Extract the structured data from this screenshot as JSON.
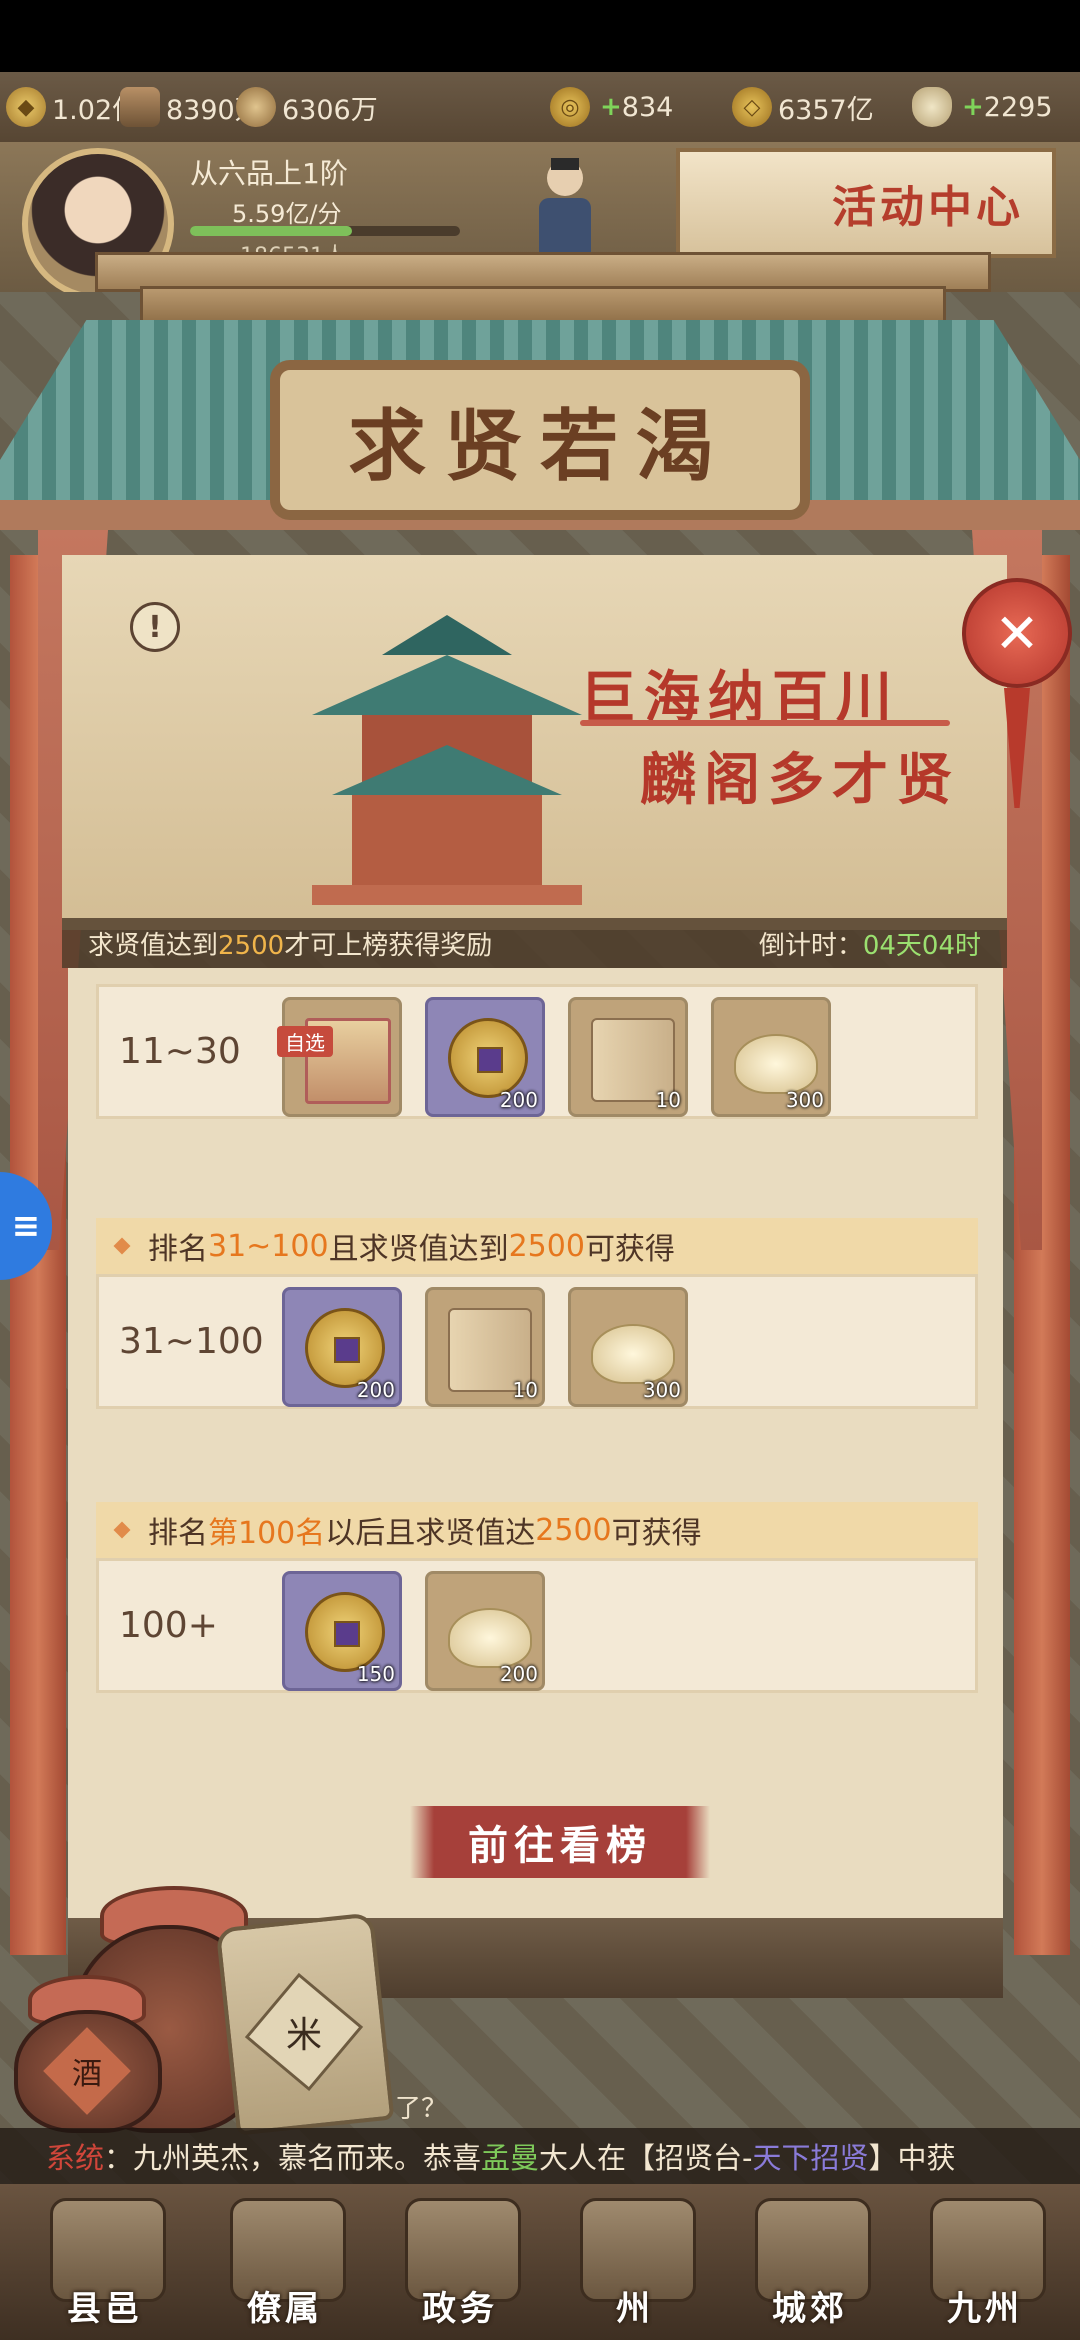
{
  "resources": [
    {
      "icon": "silver-icon",
      "value": "1.02亿",
      "plus": false
    },
    {
      "icon": "wood-icon",
      "value": "8390万",
      "plus": false
    },
    {
      "icon": "grain-icon",
      "value": "6306万",
      "plus": false
    },
    {
      "icon": "coin-icon",
      "value": "834",
      "plus": true
    },
    {
      "icon": "copper-coin-icon",
      "value": "6357亿",
      "plus": false
    },
    {
      "icon": "ingot-icon",
      "value": "2295",
      "plus": true
    }
  ],
  "player": {
    "rank": "从六品上1阶",
    "rate": "5.59亿/分",
    "people": "186531人"
  },
  "activity_center": "活动中心",
  "modal": {
    "title": "求贤若渴",
    "slogan_line1": "巨海纳百川",
    "slogan_line2": "麟阁多才贤",
    "notice_prefix": "求贤值达到",
    "notice_value": "2500",
    "notice_suffix": "才可上榜获得奖励",
    "countdown_label": "倒计时：",
    "countdown_value": "04天04时",
    "info_symbol": "!",
    "close_symbol": "✕",
    "zixuan_badge": "自选",
    "tiers": [
      {
        "label": "11~30",
        "rewards": [
          {
            "item": "chest-icon",
            "qty": ""
          },
          {
            "item": "copper-coin-icon",
            "qty": "200"
          },
          {
            "item": "scroll-icon",
            "qty": "10"
          },
          {
            "item": "ingot-icon",
            "qty": "300"
          }
        ]
      },
      {
        "label": "31~100",
        "rewards": [
          {
            "item": "copper-coin-icon",
            "qty": "200"
          },
          {
            "item": "scroll-icon",
            "qty": "10"
          },
          {
            "item": "ingot-icon",
            "qty": "300"
          }
        ]
      },
      {
        "label": "100+",
        "rewards": [
          {
            "item": "copper-coin-icon",
            "qty": "150"
          },
          {
            "item": "ingot-icon",
            "qty": "200"
          }
        ]
      }
    ],
    "section2": {
      "a": "排名",
      "b": "31~100",
      "c": "且求贤值达到",
      "d": "2500",
      "e": "可获得"
    },
    "section3": {
      "a": "排名",
      "b": "第100名",
      "c": "以后且求贤值达",
      "d": "2500",
      "e": "可获得"
    },
    "goto_button": "前往看榜"
  },
  "props": {
    "wine_label": "酒",
    "rice_label": "米",
    "partial_text": "了？"
  },
  "side_tab": "≡",
  "ticker": {
    "system": "系统",
    "part1": "：九州英杰，慕名而来。恭喜",
    "name": "孟曼",
    "part2": "大人在【招贤台-",
    "highlight": "天下招贤",
    "part3": "】中获"
  },
  "nav": [
    "县邑",
    "僚属",
    "政务",
    "州",
    "城郊",
    "九州"
  ]
}
